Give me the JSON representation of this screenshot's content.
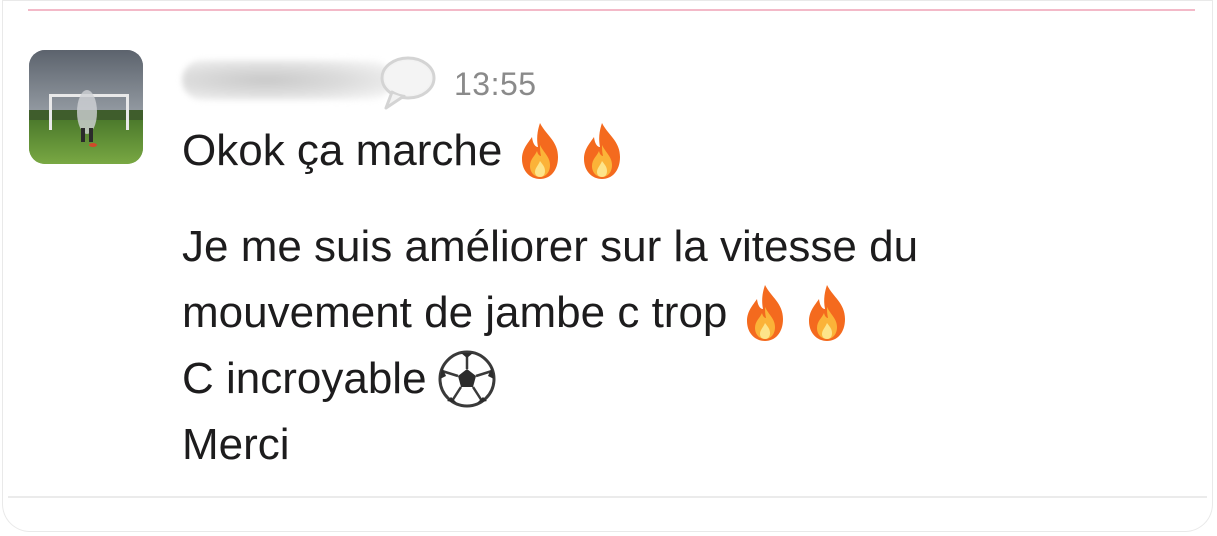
{
  "message": {
    "author_name": "",
    "timestamp": "13:55",
    "lines": {
      "first": "Okok ça marche",
      "second": "Je me suis améliorer sur la vitesse du",
      "third": "mouvement de jambe c trop",
      "fourth": "C incroyable",
      "fifth": "Merci"
    },
    "emojis": {
      "first_line": [
        "fire-emoji",
        "fire-emoji"
      ],
      "third_line": [
        "fire-emoji",
        "fire-emoji"
      ],
      "fourth_line": [
        "soccer-ball-emoji"
      ]
    }
  },
  "colors": {
    "text": "#1d1c1d",
    "timestamp": "#8a8a8a",
    "top_divider": "#f3b9c8",
    "bottom_divider": "#ebebeb"
  }
}
